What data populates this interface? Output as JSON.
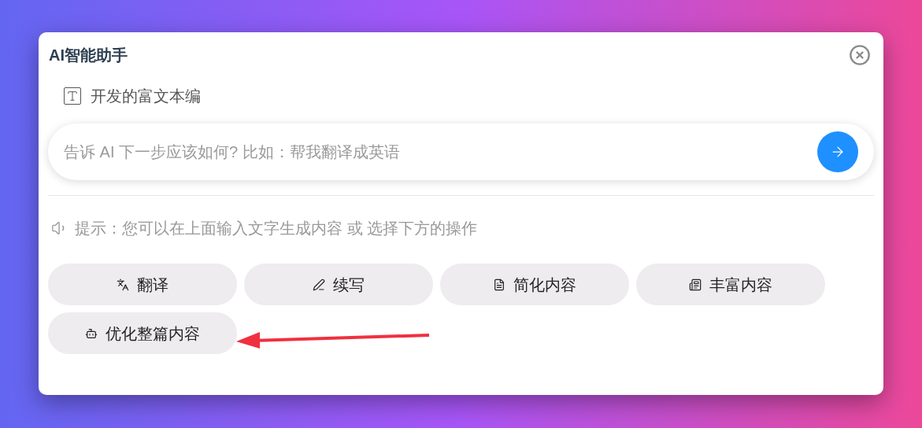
{
  "dialog": {
    "title": "AI智能助手"
  },
  "selection": {
    "text": "开发的富文本编"
  },
  "prompt": {
    "placeholder": "告诉 AI 下一步应该如何? 比如：帮我翻译成英语"
  },
  "hint": "提示：您可以在上面输入文字生成内容 或 选择下方的操作",
  "actions": [
    {
      "label": "翻译"
    },
    {
      "label": "续写"
    },
    {
      "label": "简化内容"
    },
    {
      "label": "丰富内容"
    },
    {
      "label": "优化整篇内容"
    }
  ]
}
